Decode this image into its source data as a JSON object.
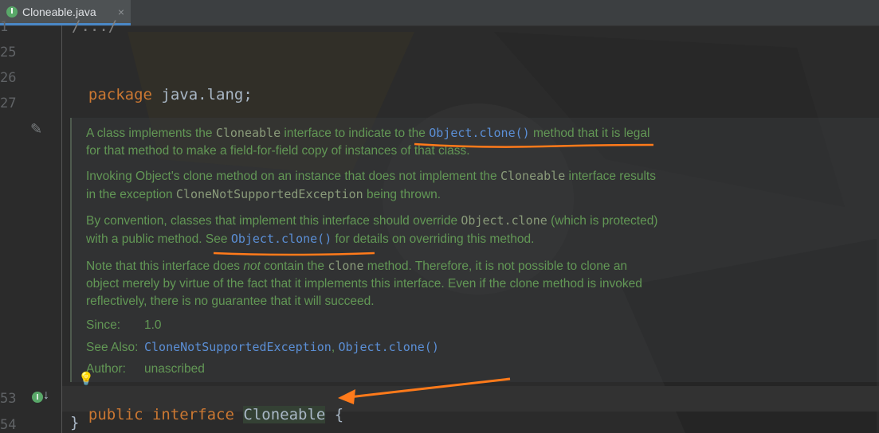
{
  "tab": {
    "icon": "interface-icon",
    "icon_letter": "I",
    "label": "Cloneable.java",
    "close": "×"
  },
  "gutter": {
    "ln_1": "1",
    "ln_25": "25",
    "ln_26": "26",
    "ln_27": "27",
    "ln_53": "53",
    "ln_54": "54"
  },
  "code": {
    "fold_line": "/.../",
    "package_kw": "package",
    "package_name": "java.lang;",
    "public_kw": "public",
    "interface_kw": "interface",
    "class_name": "Cloneable",
    "open_brace": "{",
    "close_brace": "}"
  },
  "doc": {
    "p1_a": "A class implements the ",
    "p1_code": "Cloneable",
    "p1_b": " interface to indicate to the ",
    "p1_link": "Object.clone()",
    "p1_c": " method that it is legal",
    "p1_d": "for that method to make a field-for-field copy of instances of that class.",
    "p2_a": "Invoking Object's clone method on an instance that does not implement the ",
    "p2_code": "Cloneable",
    "p2_b": " interface results",
    "p2_c": "in the exception ",
    "p2_code2": "CloneNotSupportedException",
    "p2_d": " being thrown.",
    "p3_a": "By convention, classes that implement this interface should override ",
    "p3_code": "Object.clone",
    "p3_b": " (which is protected)",
    "p3_c": "with a public method. See ",
    "p3_link": "Object.clone()",
    "p3_d": " for details on overriding this method.",
    "p4_a": "Note that this interface does ",
    "p4_em": "not",
    "p4_b": " contain the ",
    "p4_code": "clone",
    "p4_c": " method. Therefore, it is not possible to clone an",
    "p4_d": "object merely by virtue of the fact that it implements this interface. Even if the clone method is invoked",
    "p4_e": "reflectively, there is no guarantee that it will succeed.",
    "since_key": "Since:",
    "since_val": "1.0",
    "see_key": "See Also:",
    "see_link1": "CloneNotSupportedException",
    "see_sep": ", ",
    "see_link2": "Object.clone()",
    "author_key": "Author:",
    "author_val": "unascribed"
  },
  "colors": {
    "keyword": "#cc7832",
    "doc_text": "#629755",
    "link": "#5b8fd6",
    "annotation": "#ff7a1a"
  }
}
